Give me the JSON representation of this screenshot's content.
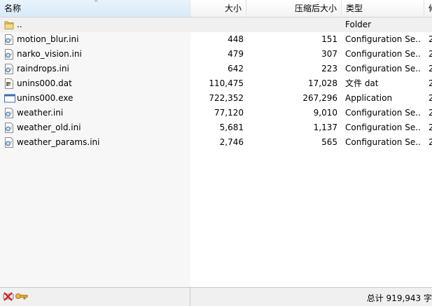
{
  "columns": {
    "name": "名称",
    "size": "大小",
    "packed": "压缩后大小",
    "type": "类型",
    "extra": "修"
  },
  "rows": [
    {
      "name": "..",
      "size": "",
      "packed": "",
      "type": "Folder",
      "extra": "",
      "icon": "folder-icon"
    },
    {
      "name": "motion_blur.ini",
      "size": "448",
      "packed": "151",
      "type": "Configuration Se...",
      "extra": "2",
      "icon": "config-file-icon"
    },
    {
      "name": "narko_vision.ini",
      "size": "479",
      "packed": "307",
      "type": "Configuration Se...",
      "extra": "2",
      "icon": "config-file-icon"
    },
    {
      "name": "raindrops.ini",
      "size": "642",
      "packed": "223",
      "type": "Configuration Se...",
      "extra": "2",
      "icon": "config-file-icon"
    },
    {
      "name": "unins000.dat",
      "size": "110,475",
      "packed": "17,028",
      "type": "文件 dat",
      "extra": "2",
      "icon": "dat-file-icon"
    },
    {
      "name": "unins000.exe",
      "size": "722,352",
      "packed": "267,296",
      "type": "Application",
      "extra": "2",
      "icon": "exe-file-icon"
    },
    {
      "name": "weather.ini",
      "size": "77,120",
      "packed": "9,010",
      "type": "Configuration Se...",
      "extra": "2",
      "icon": "config-file-icon"
    },
    {
      "name": "weather_old.ini",
      "size": "5,681",
      "packed": "1,137",
      "type": "Configuration Se...",
      "extra": "2",
      "icon": "config-file-icon"
    },
    {
      "name": "weather_params.ini",
      "size": "2,746",
      "packed": "565",
      "type": "Configuration Se...",
      "extra": "2",
      "icon": "config-file-icon"
    }
  ],
  "status": {
    "total": "总计 919,943 字"
  }
}
